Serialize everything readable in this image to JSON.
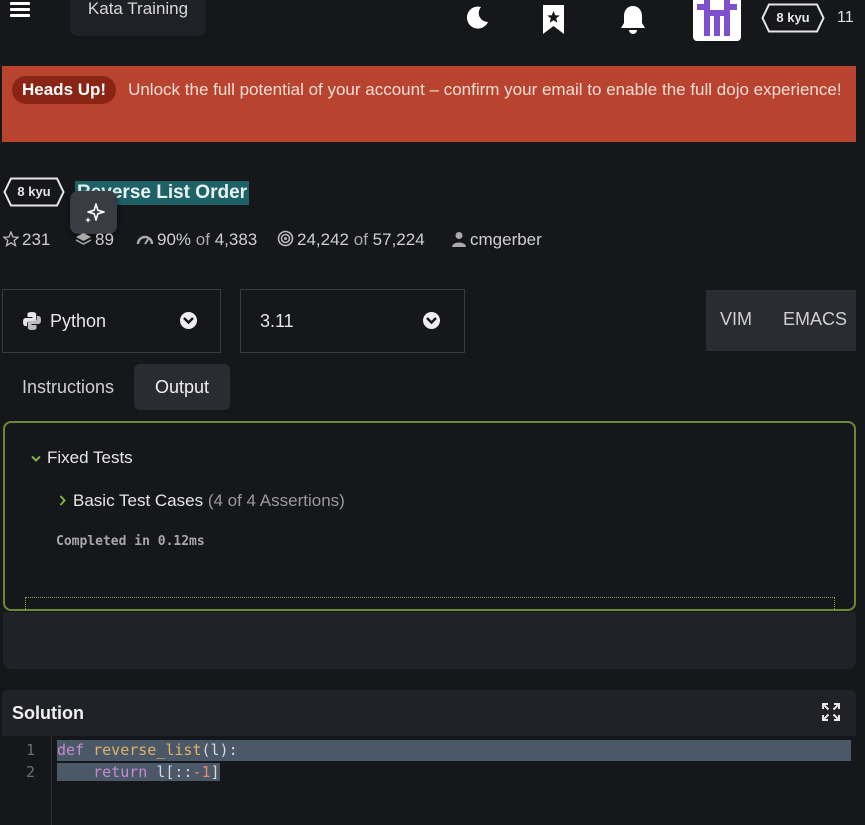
{
  "header": {
    "app_label": "Kata Training",
    "user_rank": "8 kyu",
    "honor": "11"
  },
  "banner": {
    "tag": "Heads Up!",
    "message": "Unlock the full potential of your account – confirm your email to enable the full dojo experience!"
  },
  "kata": {
    "rank": "8 kyu",
    "title": "Reverse List Order",
    "stars": "231",
    "collections": "89",
    "satisfaction": "90%",
    "satisfaction_of": "of",
    "satisfaction_votes": "4,383",
    "completed": "24,242",
    "completed_of": "of",
    "attempts": "57,224",
    "author": "cmgerber"
  },
  "language": {
    "selected": "Python"
  },
  "version": {
    "selected": "3.11"
  },
  "editor_modes": {
    "vim": "VIM",
    "emacs": "EMACS"
  },
  "tabs": {
    "instructions": "Instructions",
    "output": "Output"
  },
  "output": {
    "group": "Fixed Tests",
    "test_name": "Basic Test Cases",
    "assertions": "(4 of 4 Assertions)",
    "completed": "Completed in 0.12ms"
  },
  "solution": {
    "title": "Solution",
    "lines": [
      {
        "num": "1",
        "kw": "def",
        "fn": "reverse_list",
        "rest": "(l):"
      },
      {
        "num": "2",
        "kw": "return",
        "body": "l[::",
        "num_lit": "-1",
        "close": "]"
      }
    ]
  },
  "colors": {
    "background": "#16171b",
    "banner": "#b8432f",
    "output_border": "#6d8a2e",
    "title_highlight": "#1e6166"
  }
}
